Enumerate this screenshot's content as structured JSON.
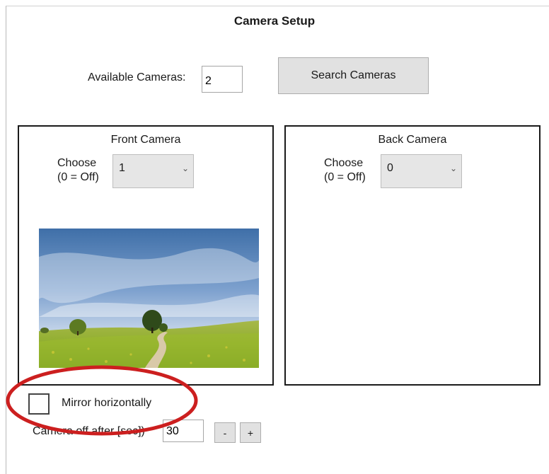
{
  "header": {
    "title": "Camera Setup"
  },
  "available": {
    "label": "Available Cameras:",
    "value": "2"
  },
  "search_button": {
    "label": "Search Cameras"
  },
  "front_camera": {
    "title": "Front Camera",
    "choose_line1": "Choose",
    "choose_line2": "(0 = Off)",
    "selected": "1",
    "preview": "landscape-preview-image"
  },
  "back_camera": {
    "title": "Back Camera",
    "choose_line1": "Choose",
    "choose_line2": "(0 = Off)",
    "selected": "0"
  },
  "mirror": {
    "label": "Mirror horizontally",
    "checked": false
  },
  "camera_off": {
    "label": "Camera off after [sec])",
    "value": "30",
    "minus_label": "-",
    "plus_label": "+"
  },
  "icons": {
    "dropdown": "chevron-down-icon",
    "checkbox": "checkbox-icon"
  },
  "colors": {
    "annotation_ring": "#cc1f1f",
    "button_face": "#e1e1e1",
    "panel_border": "#1a1a1a"
  }
}
